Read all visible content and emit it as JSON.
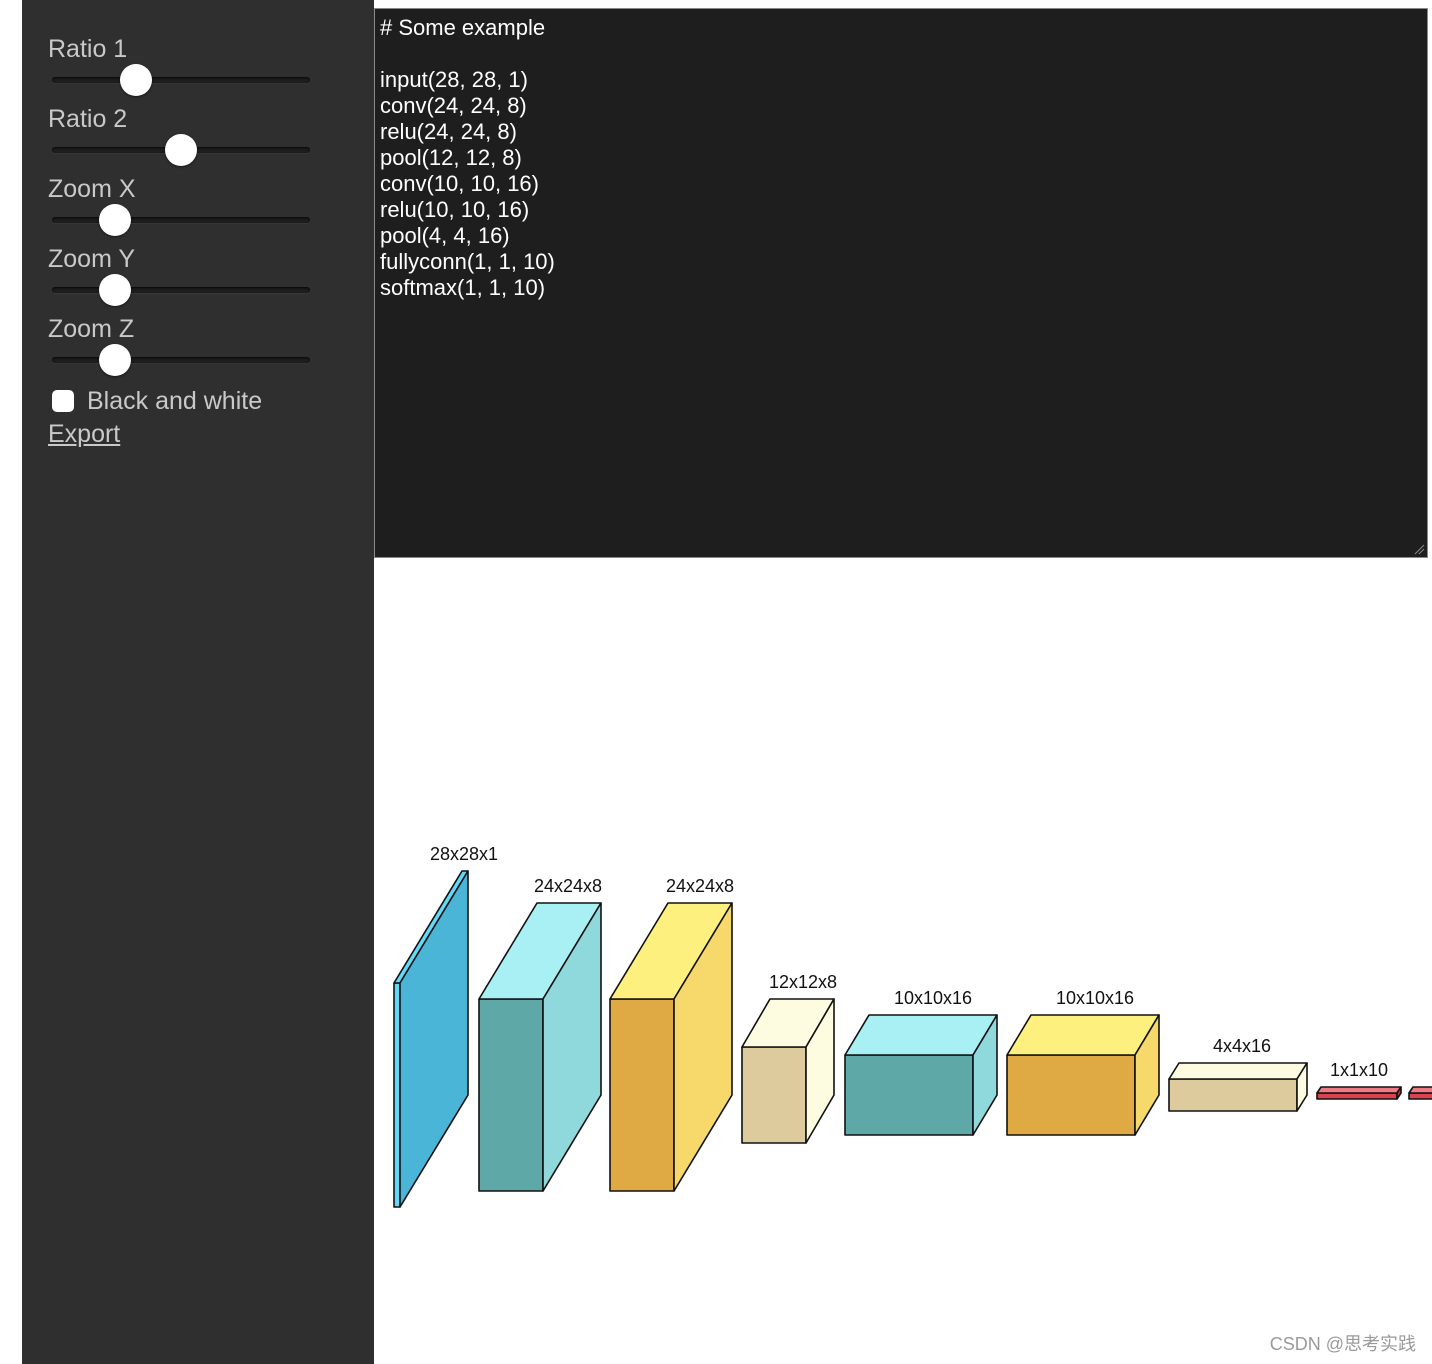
{
  "sidebar": {
    "controls": [
      {
        "label": "Ratio 1",
        "value": 0.3
      },
      {
        "label": "Ratio 2",
        "value": 0.5
      },
      {
        "label": "Zoom X",
        "value": 0.21
      },
      {
        "label": "Zoom Y",
        "value": 0.21
      },
      {
        "label": "Zoom Z",
        "value": 0.21
      }
    ],
    "checkbox": {
      "label": "Black and white",
      "checked": false
    },
    "export_label": "Export"
  },
  "editor": {
    "code": "# Some example\n\ninput(28, 28, 1)\nconv(24, 24, 8)\nrelu(24, 24, 8)\npool(12, 12, 8)\nconv(10, 10, 16)\nrelu(10, 10, 16)\npool(4, 4, 16)\nfullyconn(1, 1, 10)\nsoftmax(1, 1, 10)"
  },
  "diagram": {
    "layers": [
      {
        "label": "28x28x1",
        "front": "#62d9f6",
        "top": "#62d9f6",
        "side": "#4bb5d8"
      },
      {
        "label": "24x24x8",
        "front": "#5ea8a8",
        "top": "#a8f0f4",
        "side": "#8fd8dc"
      },
      {
        "label": "24x24x8",
        "front": "#dfaa44",
        "top": "#fdf07e",
        "side": "#f7d86a"
      },
      {
        "label": "12x12x8",
        "front": "#decb9d",
        "top": "#fdfbe0",
        "side": "#fdfbe0"
      },
      {
        "label": "10x10x16",
        "front": "#5ea8a8",
        "top": "#a8f0f4",
        "side": "#8fd8dc"
      },
      {
        "label": "10x10x16",
        "front": "#dfaa44",
        "top": "#fdf07e",
        "side": "#f7d86a"
      },
      {
        "label": "4x4x16",
        "front": "#decb9d",
        "top": "#fdfbe0",
        "side": "#fdfbe0"
      },
      {
        "label": "1x1x10",
        "front": "#d9434f",
        "top": "#f07a84",
        "side": "#c7343f"
      },
      {
        "label": "",
        "front": "#d9434f",
        "top": "#f07a84",
        "side": "#c7343f"
      }
    ]
  },
  "watermark": "CSDN @思考实践"
}
